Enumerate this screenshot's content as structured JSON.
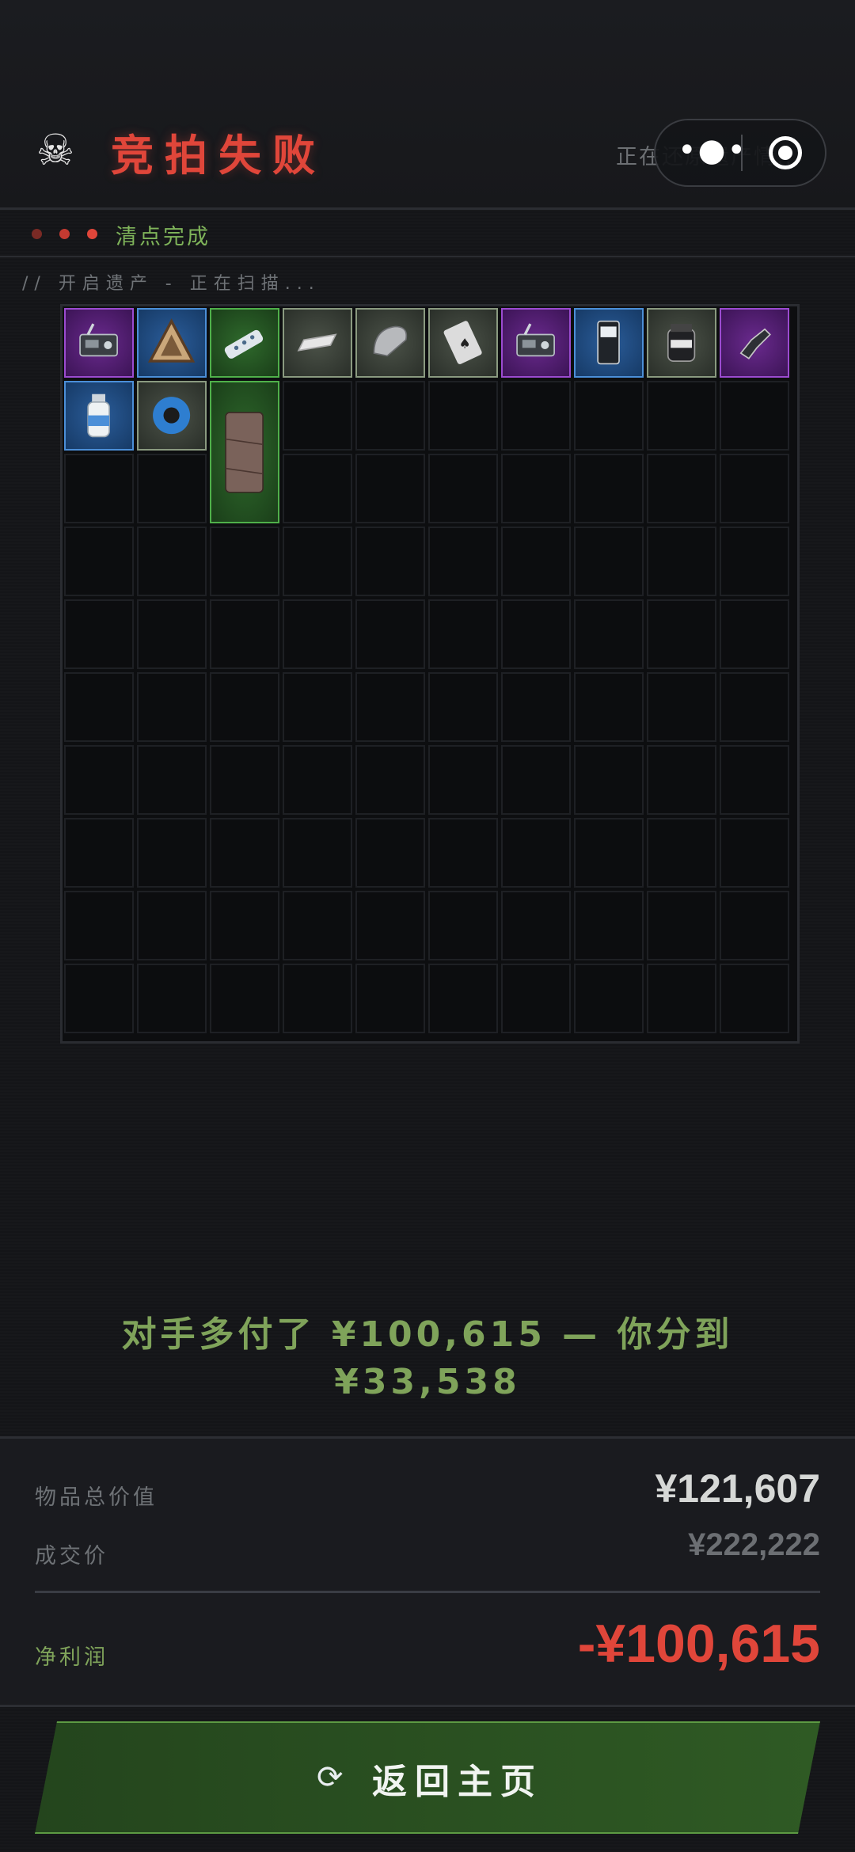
{
  "header": {
    "skull_icon": "skull-icon",
    "title": "竞拍失败",
    "background_status": "正在还原遗产情...",
    "capsule": {
      "more_icon": "more-dots-icon",
      "close_icon": "target-close-icon"
    }
  },
  "status": {
    "text": "清点完成",
    "dot_colors": [
      "#7a2a25",
      "#c43a31",
      "#e0463a"
    ]
  },
  "scan_text": "// 开启遗产 - 正在扫描...",
  "grid": {
    "columns": 10,
    "rows": 10,
    "items": [
      {
        "name": "radio-device",
        "icon": "radio-icon",
        "rarity": "purple",
        "col": 0,
        "row": 0,
        "w": 1,
        "h": 1
      },
      {
        "name": "triangle-badge",
        "icon": "triangle-icon",
        "rarity": "blue",
        "col": 1,
        "row": 0,
        "w": 1,
        "h": 1
      },
      {
        "name": "power-strip",
        "icon": "power-strip-icon",
        "rarity": "green",
        "col": 2,
        "row": 0,
        "w": 1,
        "h": 1
      },
      {
        "name": "paper-note",
        "icon": "paper-icon",
        "rarity": "gray",
        "col": 3,
        "row": 0,
        "w": 1,
        "h": 1
      },
      {
        "name": "computer-mouse",
        "icon": "mouse-icon",
        "rarity": "gray",
        "col": 4,
        "row": 0,
        "w": 1,
        "h": 1
      },
      {
        "name": "playing-card",
        "icon": "card-icon",
        "rarity": "gray",
        "col": 5,
        "row": 0,
        "w": 1,
        "h": 1
      },
      {
        "name": "radio-device-2",
        "icon": "radio-icon",
        "rarity": "purple",
        "col": 6,
        "row": 0,
        "w": 1,
        "h": 1
      },
      {
        "name": "snack-pack",
        "icon": "pack-icon",
        "rarity": "blue",
        "col": 7,
        "row": 0,
        "w": 1,
        "h": 1
      },
      {
        "name": "supplement-jar",
        "icon": "jar-icon",
        "rarity": "gray",
        "col": 8,
        "row": 0,
        "w": 1,
        "h": 1
      },
      {
        "name": "tactical-part",
        "icon": "tactical-icon",
        "rarity": "purple",
        "col": 9,
        "row": 0,
        "w": 1,
        "h": 1
      },
      {
        "name": "water-bottle",
        "icon": "bottle-icon",
        "rarity": "blue",
        "col": 0,
        "row": 1,
        "w": 1,
        "h": 1
      },
      {
        "name": "tape-roll",
        "icon": "tape-icon",
        "rarity": "gray",
        "col": 1,
        "row": 1,
        "w": 1,
        "h": 1
      },
      {
        "name": "leather-wallet",
        "icon": "wallet-icon",
        "rarity": "green",
        "col": 2,
        "row": 1,
        "w": 1,
        "h": 2
      }
    ]
  },
  "message": {
    "line1": "对手多付了 ¥100,615 — 你分到",
    "line2": "¥33,538"
  },
  "summary": {
    "total_value_label": "物品总价值",
    "total_value": "¥121,607",
    "deal_price_label": "成交价",
    "deal_price": "¥222,222",
    "net_profit_label": "净利润",
    "net_profit": "-¥100,615"
  },
  "colors": {
    "accent_red": "#e0463a",
    "accent_green": "#7fb45a",
    "purple": "#9b4bd0",
    "blue": "#4b8fd8",
    "green": "#4fb04a",
    "gray": "#8a9a80"
  },
  "button": {
    "icon": "refresh-icon",
    "label": "返回主页"
  }
}
